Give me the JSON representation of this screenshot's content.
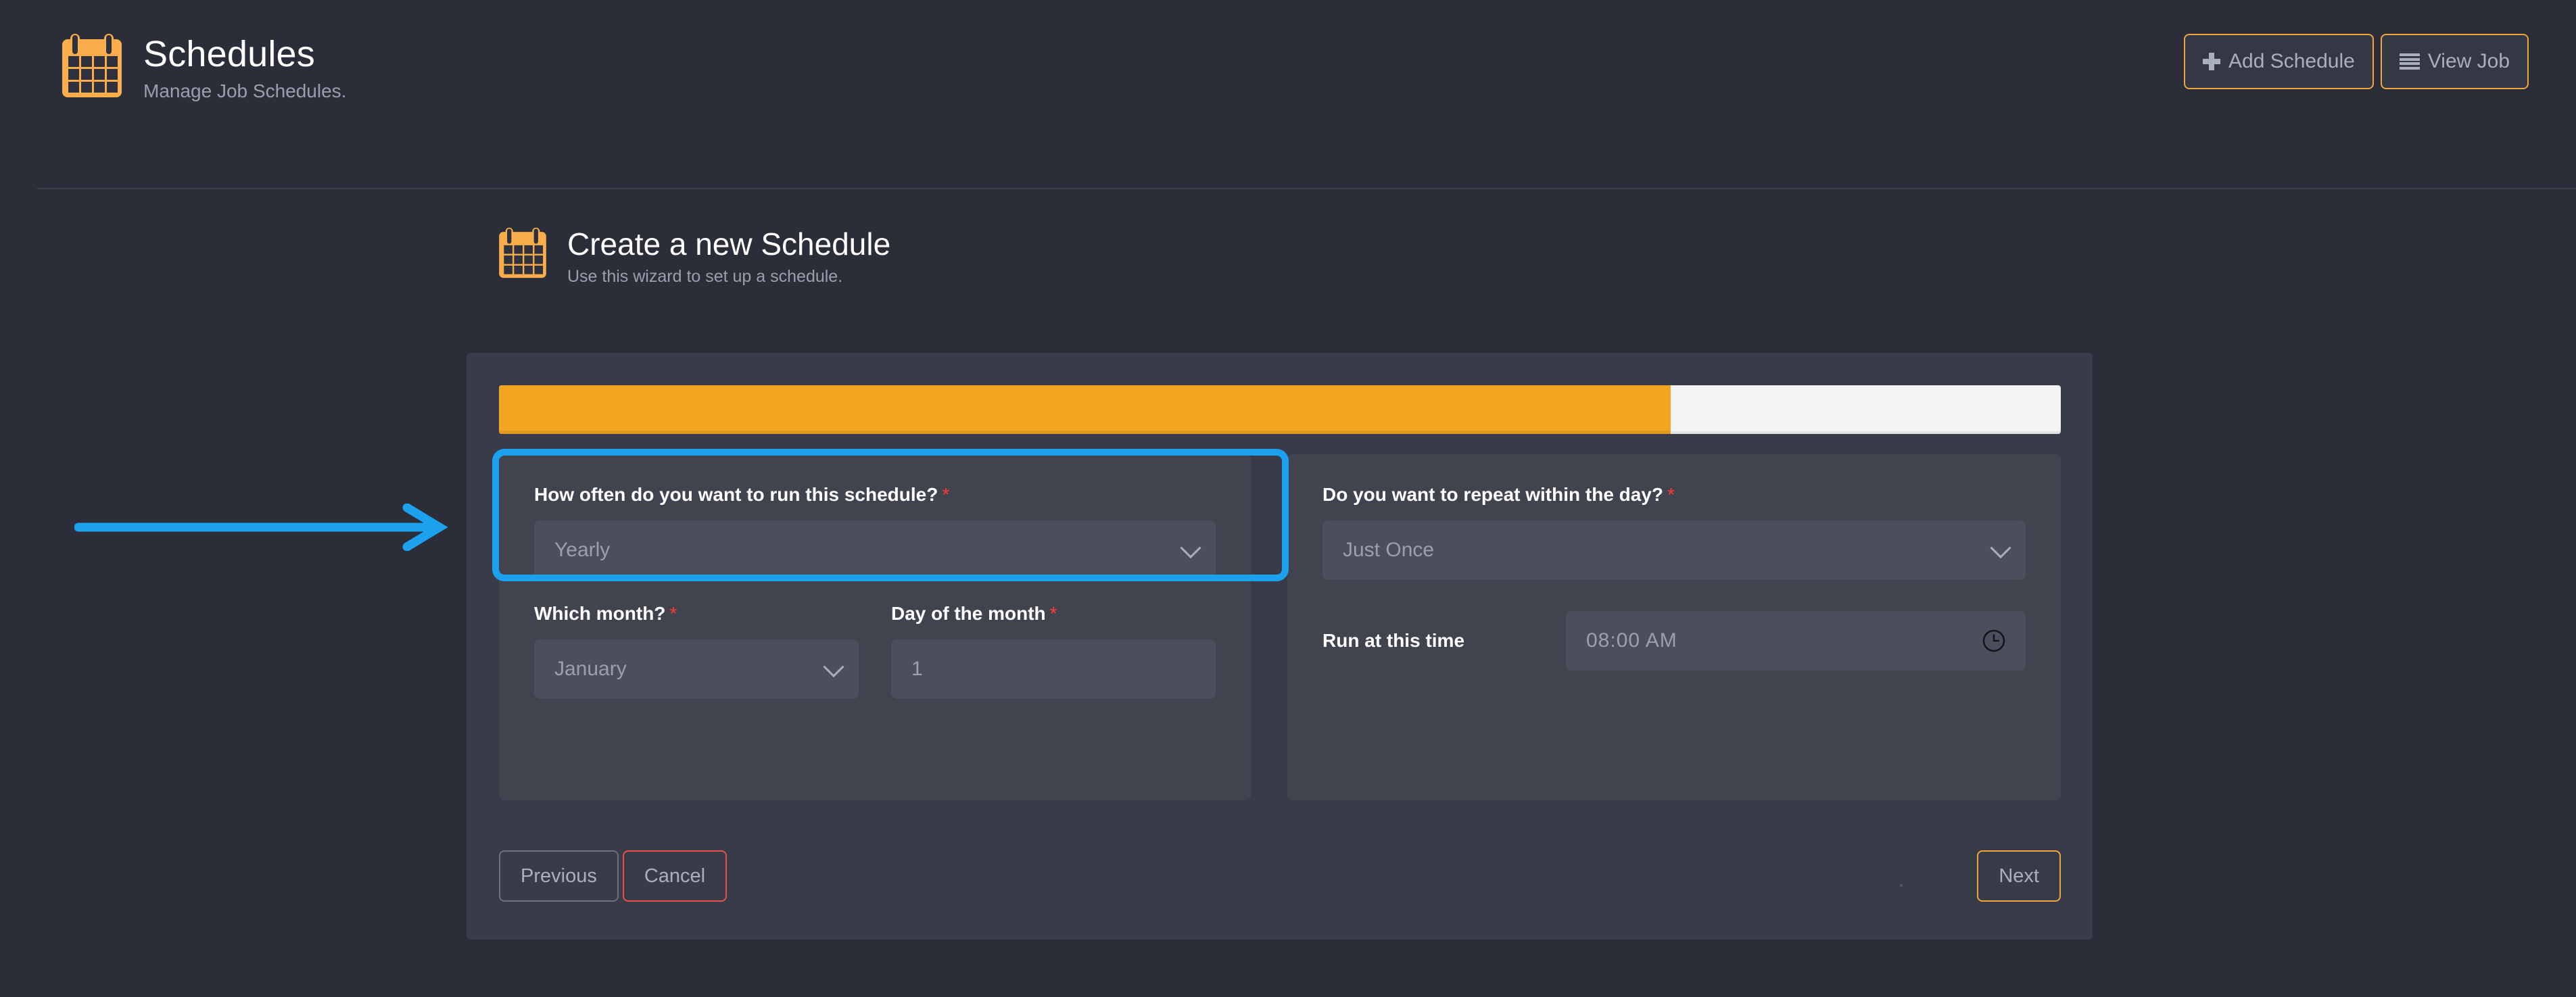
{
  "header": {
    "icon": "calendar-icon",
    "title": "Schedules",
    "subtitle": "Manage Job Schedules.",
    "actions": [
      {
        "icon": "plus-icon",
        "label": "Add Schedule"
      },
      {
        "icon": "list-icon",
        "label": "View Job"
      }
    ]
  },
  "wizard": {
    "icon": "calendar-icon",
    "title": "Create a new Schedule",
    "subtitle": "Use this wizard to set up a schedule.",
    "progress": {
      "percent": 75,
      "fill_color": "#f4a623",
      "track_color": "#f3f3f3"
    },
    "left_panel": {
      "frequency": {
        "label": "How often do you want to run this schedule?",
        "required_marker": "*",
        "value": "Yearly",
        "focused": true
      },
      "month": {
        "label": "Which month?",
        "required_marker": "*",
        "value": "January"
      },
      "day_of_month": {
        "label": "Day of the month",
        "required_marker": "*",
        "value": "1"
      }
    },
    "right_panel": {
      "repeat": {
        "label": "Do you want to repeat within the day?",
        "required_marker": "*",
        "value": "Just Once"
      },
      "run_time": {
        "label": "Run at this time",
        "value": "08:00 AM",
        "icon": "clock-icon"
      }
    },
    "footer": {
      "previous_label": "Previous",
      "cancel_label": "Cancel",
      "next_label": "Next"
    }
  },
  "annotation": {
    "arrow": "right-arrow-annotation",
    "color": "#1ca1ef"
  },
  "colors": {
    "page_background": "#2b2e39",
    "card_background": "#383c49",
    "panel_background": "#41434f",
    "control_background": "#4c4f5b",
    "accent_orange": "#f2a33c",
    "danger_red": "#e8514b",
    "required_red": "#ff3b30",
    "focus_blue": "#1ca1ef",
    "text_primary": "#ffffff",
    "text_muted": "#9aa0ab"
  }
}
